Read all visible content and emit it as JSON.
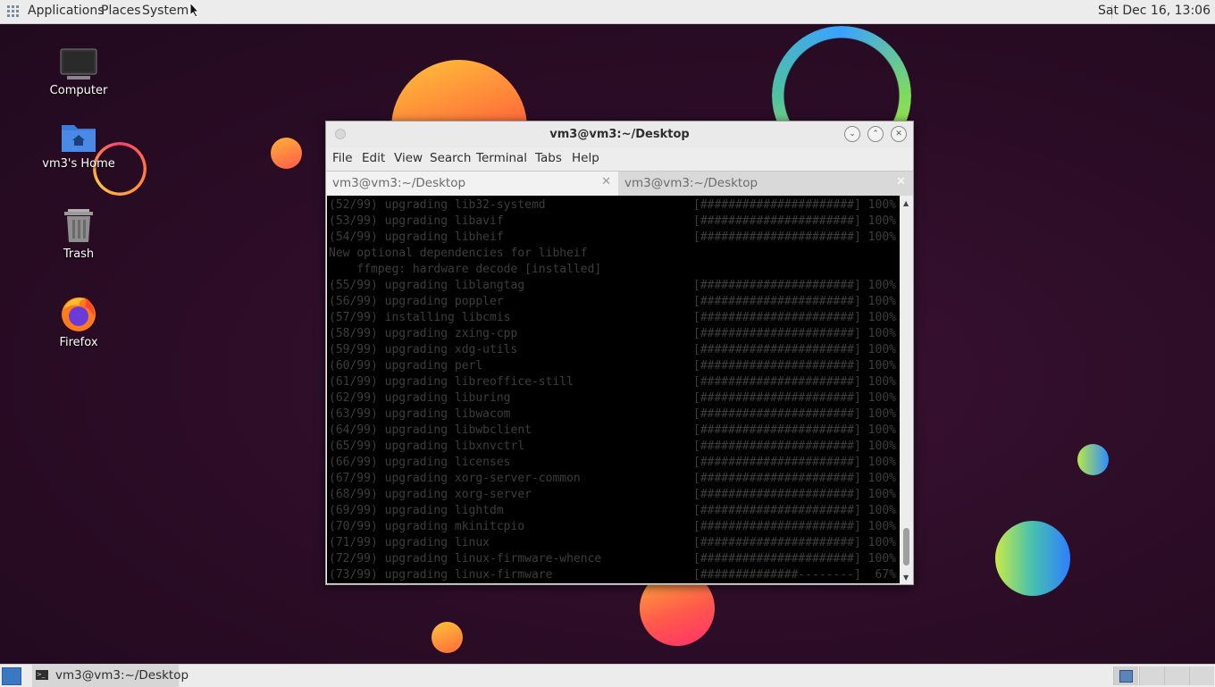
{
  "top_panel": {
    "menu": [
      "Applications",
      "Places",
      "System"
    ],
    "clock": "Sat Dec 16, 13:06"
  },
  "desktop": {
    "icons": [
      {
        "label": "Computer",
        "icon": "computer-icon"
      },
      {
        "label": "vm3's Home",
        "icon": "home-folder-icon"
      },
      {
        "label": "Trash",
        "icon": "trash-icon"
      },
      {
        "label": "Firefox",
        "icon": "firefox-icon"
      }
    ]
  },
  "terminal": {
    "title": "vm3@vm3:~/Desktop",
    "menu": [
      "File",
      "Edit",
      "View",
      "Search",
      "Terminal",
      "Tabs",
      "Help"
    ],
    "tabs": [
      {
        "label": "vm3@vm3:~/Desktop",
        "active": true
      },
      {
        "label": "vm3@vm3:~/Desktop",
        "active": false
      }
    ],
    "lines": [
      {
        "text": "(52/99) upgrading lib32-systemd",
        "progress": "[######################] 100%"
      },
      {
        "text": "(53/99) upgrading libavif",
        "progress": "[######################] 100%"
      },
      {
        "text": "(54/99) upgrading libheif",
        "progress": "[######################] 100%"
      },
      {
        "text": "New optional dependencies for libheif",
        "progress": ""
      },
      {
        "text": "    ffmpeg: hardware decode [installed]",
        "progress": ""
      },
      {
        "text": "(55/99) upgrading liblangtag",
        "progress": "[######################] 100%"
      },
      {
        "text": "(56/99) upgrading poppler",
        "progress": "[######################] 100%"
      },
      {
        "text": "(57/99) installing libcmis",
        "progress": "[######################] 100%"
      },
      {
        "text": "(58/99) upgrading zxing-cpp",
        "progress": "[######################] 100%"
      },
      {
        "text": "(59/99) upgrading xdg-utils",
        "progress": "[######################] 100%"
      },
      {
        "text": "(60/99) upgrading perl",
        "progress": "[######################] 100%"
      },
      {
        "text": "(61/99) upgrading libreoffice-still",
        "progress": "[######################] 100%"
      },
      {
        "text": "(62/99) upgrading liburing",
        "progress": "[######################] 100%"
      },
      {
        "text": "(63/99) upgrading libwacom",
        "progress": "[######################] 100%"
      },
      {
        "text": "(64/99) upgrading libwbclient",
        "progress": "[######################] 100%"
      },
      {
        "text": "(65/99) upgrading libxnvctrl",
        "progress": "[######################] 100%"
      },
      {
        "text": "(66/99) upgrading licenses",
        "progress": "[######################] 100%"
      },
      {
        "text": "(67/99) upgrading xorg-server-common",
        "progress": "[######################] 100%"
      },
      {
        "text": "(68/99) upgrading xorg-server",
        "progress": "[######################] 100%"
      },
      {
        "text": "(69/99) upgrading lightdm",
        "progress": "[######################] 100%"
      },
      {
        "text": "(70/99) upgrading mkinitcpio",
        "progress": "[######################] 100%"
      },
      {
        "text": "(71/99) upgrading linux",
        "progress": "[######################] 100%"
      },
      {
        "text": "(72/99) upgrading linux-firmware-whence",
        "progress": "[######################] 100%"
      },
      {
        "text": "(73/99) upgrading linux-firmware",
        "progress": "[##############--------]  67%"
      }
    ]
  },
  "taskbar": {
    "task_label": "vm3@vm3:~/Desktop",
    "workspaces": 4
  },
  "colors": {
    "desktop_bg": "#2b0c26",
    "panel_bg": "#ececec",
    "terminal_bg": "#000000",
    "terminal_text": "#3d3d3d"
  }
}
